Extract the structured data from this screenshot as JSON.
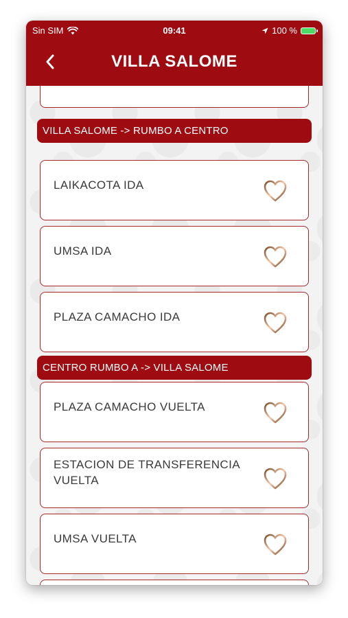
{
  "status": {
    "carrier": "Sin SIM",
    "time": "09:41",
    "battery": "100 %"
  },
  "header": {
    "title": "VILLA SALOME"
  },
  "sections": [
    {
      "title": "VILLA SALOME -> RUMBO A CENTRO",
      "items": [
        "LAIKACOTA IDA",
        "UMSA IDA",
        "PLAZA CAMACHO IDA"
      ]
    },
    {
      "title": "CENTRO RUMBO A -> VILLA SALOME",
      "items": [
        "PLAZA CAMACHO VUELTA",
        "ESTACION DE TRANSFERENCIA VUELTA",
        "UMSA VUELTA"
      ]
    }
  ],
  "colors": {
    "brand": "#9e0b10",
    "card_border": "#a8262b",
    "heart_gradient": [
      "#7a4a2a",
      "#f3c9a8",
      "#6b3a1f"
    ]
  },
  "icons": {
    "back": "chevron-left-icon",
    "favorite": "heart-outline-icon",
    "wifi": "wifi-icon",
    "location": "location-arrow-icon",
    "battery": "battery-icon"
  }
}
